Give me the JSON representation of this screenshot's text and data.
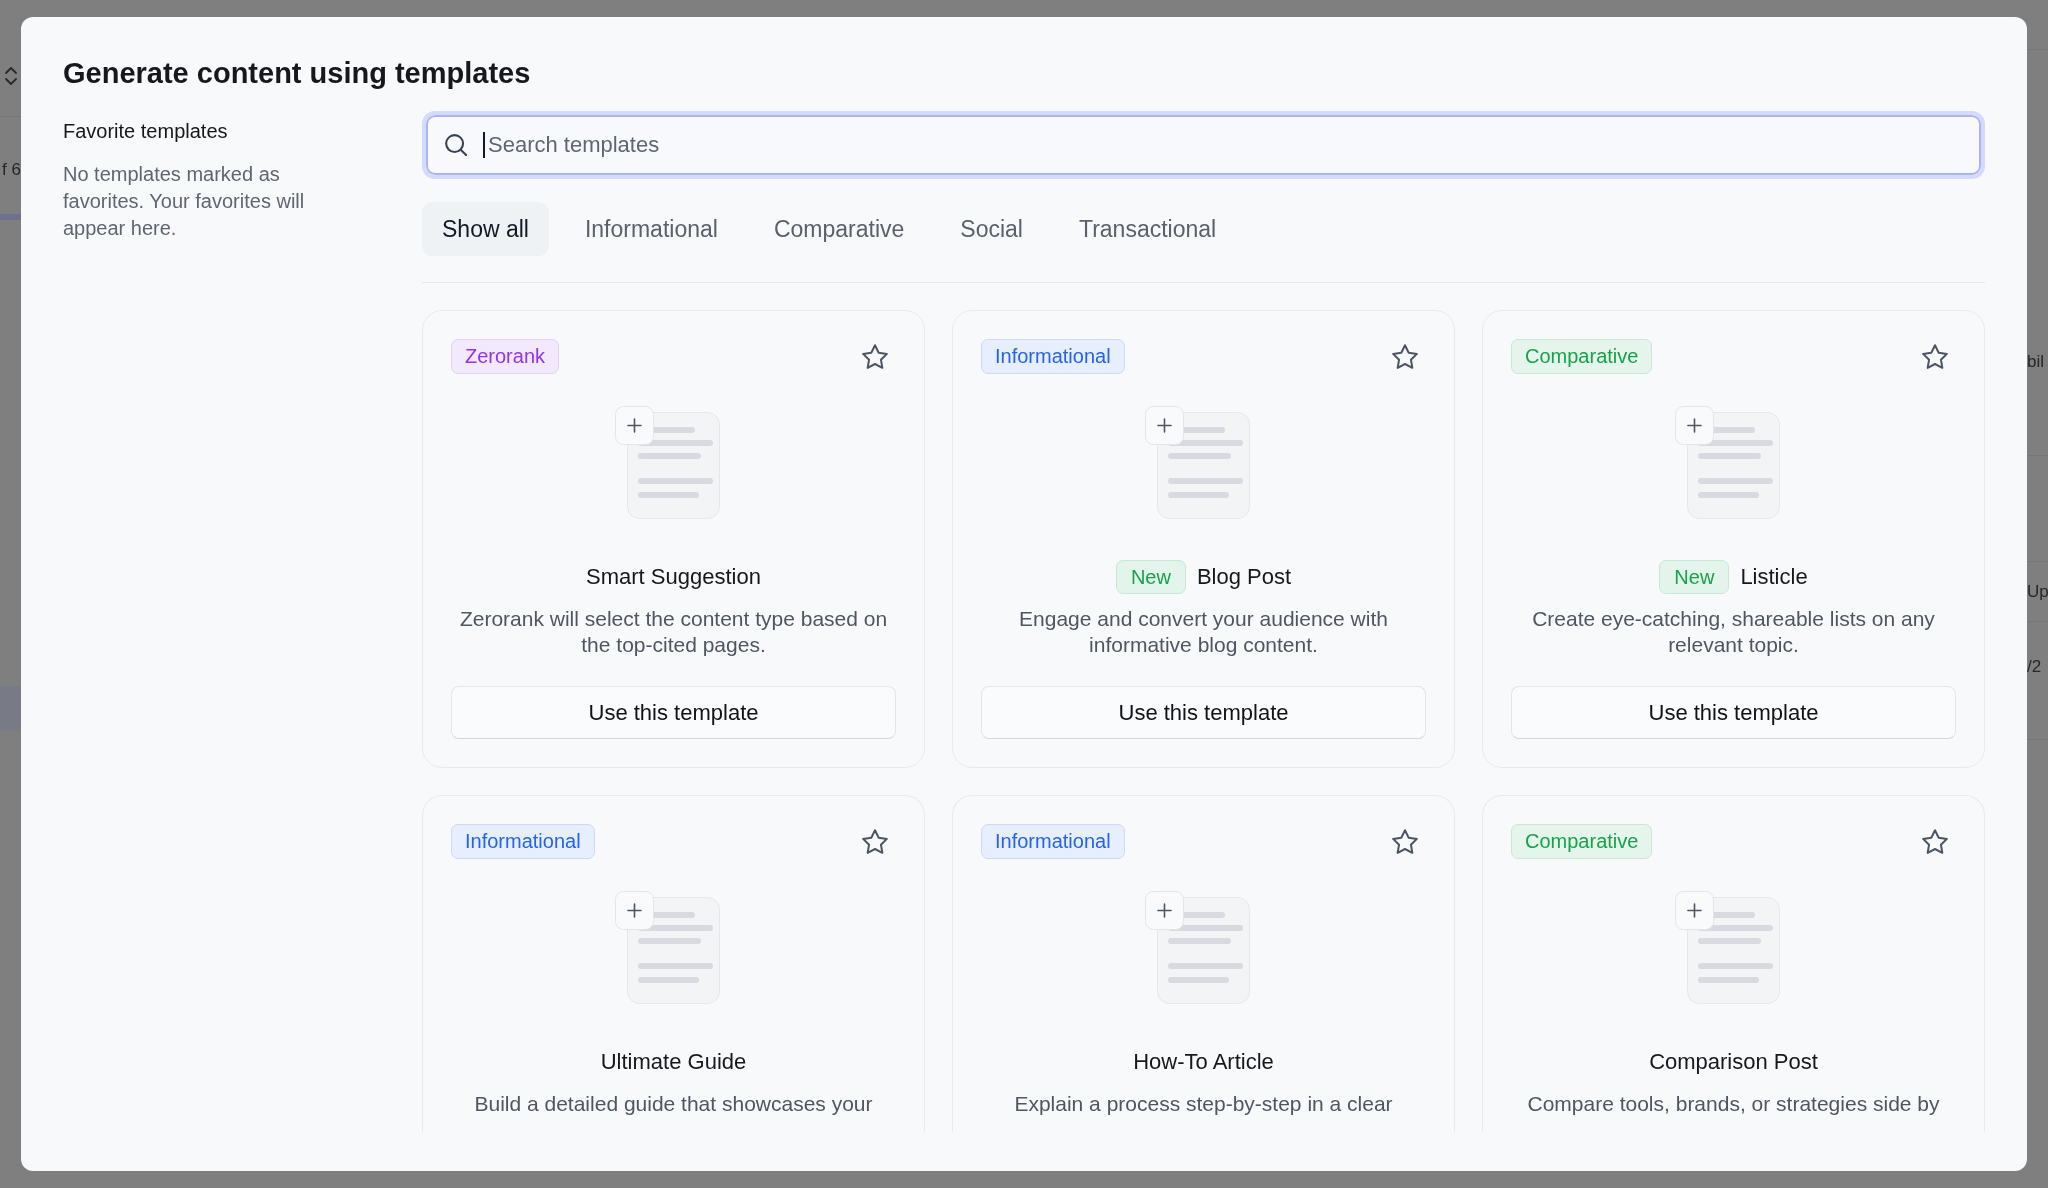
{
  "background_page": {
    "left_texts": [
      "f 6"
    ],
    "right_texts": [
      "bil",
      "Up",
      "/2"
    ]
  },
  "dialog": {
    "title": "Generate content using templates"
  },
  "favorites": {
    "heading": "Favorite templates",
    "empty_message": "No templates marked as favorites. Your favorites will appear here."
  },
  "search": {
    "placeholder": "Search templates",
    "focused": true
  },
  "tabs": [
    {
      "label": "Show all",
      "selected": true
    },
    {
      "label": "Informational",
      "selected": false
    },
    {
      "label": "Comparative",
      "selected": false
    },
    {
      "label": "Social",
      "selected": false
    },
    {
      "label": "Transactional",
      "selected": false
    }
  ],
  "cards": [
    {
      "badge": {
        "label": "Zerorank",
        "color": "#9333ea"
      },
      "favorite": false,
      "title": "Smart Suggestion",
      "description": "Zerorank will select the content type based on the top-cited pages.",
      "button": "Use this template"
    },
    {
      "badge": {
        "label": "Informational",
        "color": "#2563eb"
      },
      "favorite": false,
      "new_badge": "New",
      "title": "Blog Post",
      "description": "Engage and convert your audience with informative blog content.",
      "button": "Use this template"
    },
    {
      "badge": {
        "label": "Comparative",
        "color": "#16a34a"
      },
      "favorite": false,
      "new_badge": "New",
      "title": "Listicle",
      "description": "Create eye-catching, shareable lists on any relevant topic.",
      "button": "Use this template"
    },
    {
      "badge": {
        "label": "Informational",
        "color": "#2563eb"
      },
      "favorite": false,
      "title": "Ultimate Guide",
      "description": "Build a detailed guide that showcases your"
    },
    {
      "badge": {
        "label": "Informational",
        "color": "#2563eb"
      },
      "favorite": false,
      "title": "How-To Article",
      "description": "Explain a process step-by-step in a clear"
    },
    {
      "badge": {
        "label": "Comparative",
        "color": "#16a34a"
      },
      "favorite": false,
      "title": "Comparison Post",
      "description": "Compare tools, brands, or strategies side by"
    }
  ]
}
